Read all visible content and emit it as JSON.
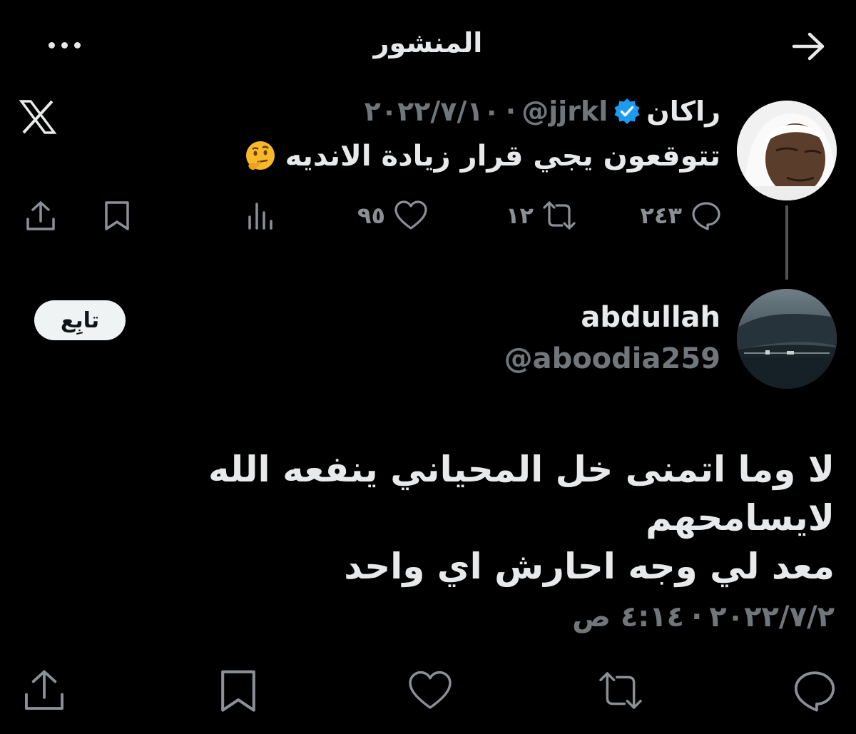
{
  "header": {
    "title": "المنشور",
    "more_icon": "more-horizontal-icon",
    "back_icon": "arrow-right-icon"
  },
  "quoted_tweet": {
    "author_name": "راكان",
    "verified_icon": "verified-badge-icon",
    "handle": "@jjrkl",
    "date": "٢٠٢٢/٧/١٠",
    "separator": "·",
    "text": "تتوقعون يجي قرار زيادة الانديه",
    "emoji": "thinking-face-emoji",
    "stats": {
      "replies": "٢٤٣",
      "retweets": "١٢",
      "likes": "٩٥"
    },
    "source_icon": "x-logo-icon"
  },
  "main_tweet": {
    "author_name": "abdullah",
    "handle": "@aboodia259",
    "follow_label": "تابِع",
    "text_line1": "لا وما اتمنى خل المحياني ينفعه  الله لايسامحهم",
    "text_line2": "معد لي وجه احارش اي واحد",
    "date": "٢٠٢٢/٧/٢",
    "separator": "·",
    "time": "٤:١٤ ص"
  },
  "colors": {
    "background": "#000000",
    "text": "#e7e9ea",
    "secondary": "#71767b",
    "verified": "#1d9bf0",
    "follow_bg": "#eff3f4"
  }
}
